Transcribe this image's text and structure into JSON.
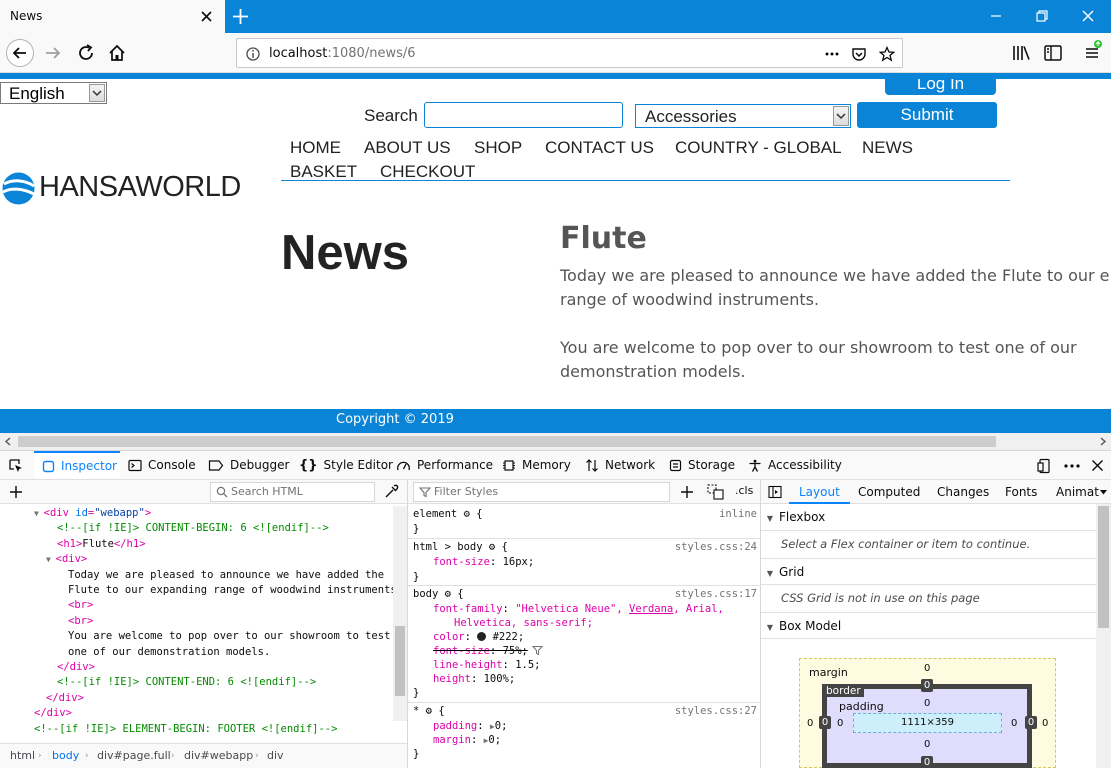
{
  "browser": {
    "tab_title": "News",
    "url_host": "localhost",
    "url_rest": ":1080/news/6"
  },
  "site": {
    "language": "English",
    "login_label": "Log In",
    "search_label": "Search",
    "search_value": "",
    "category": "Accessories",
    "submit_label": "Submit",
    "logo_text": "HANSAWORLD",
    "menu": [
      "HOME",
      "ABOUT US",
      "SHOP",
      "CONTACT US",
      "COUNTRY - GLOBAL",
      "NEWS",
      "BASKET",
      "CHECKOUT"
    ],
    "page_heading": "News",
    "article_title": "Flute",
    "article_p1_line1": "Today we are pleased to announce we have added the Flute to our e",
    "article_p1_line2": "range of woodwind instruments.",
    "article_p2_line1": "You are welcome to pop over to our showroom to test one of our",
    "article_p2_line2": "demonstration models.",
    "footer": "Copyright © 2019"
  },
  "devtools": {
    "tabs": [
      "Inspector",
      "Console",
      "Debugger",
      "Style Editor",
      "Performance",
      "Memory",
      "Network",
      "Storage",
      "Accessibility"
    ],
    "search_html_placeholder": "Search HTML",
    "filter_styles_placeholder": "Filter Styles",
    "cls_label": ".cls",
    "html_tree": [
      {
        "tag_open": "<div ",
        "attr": "id",
        "val": "\"webapp\"",
        "tag_close": ">"
      },
      {
        "comment": "<!--[if !IE]> CONTENT-BEGIN: 6 <![endif]-->"
      },
      {
        "h1_open": "<h1>",
        "h1_text": "Flute",
        "h1_close": "</h1>"
      },
      {
        "div_open": "<div>"
      },
      {
        "text1": "Today we are pleased to announce we have added the"
      },
      {
        "text2": "Flute to our expanding range of woodwind instruments."
      },
      {
        "br1": "<br>"
      },
      {
        "br2": "<br>"
      },
      {
        "text3": "You are welcome to pop over to our showroom to test"
      },
      {
        "text4": "one of our demonstration models."
      },
      {
        "div_close1": "</div>"
      },
      {
        "comment2": "<!--[if !IE]> CONTENT-END: 6 <![endif]-->"
      },
      {
        "div_close2": "</div>"
      },
      {
        "div_close3": "</div>"
      },
      {
        "comment3": "<!--[if !IE]> ELEMENT-BEGIN: FOOTER <![endif]-->"
      }
    ],
    "breadcrumbs": [
      "html",
      "body",
      "div#page.full",
      "div#webapp",
      "div"
    ],
    "rules": {
      "element": {
        "selector": "element",
        "brace": "{",
        "source": "inline",
        "close": "}"
      },
      "html_body": {
        "selector": "html > body",
        "brace": "{",
        "source": "styles.css:24",
        "prop": "font-size",
        "val": "16px;",
        "close": "}"
      },
      "body": {
        "selector": "body",
        "brace": "{",
        "source": "styles.css:17",
        "ff_prop": "font-family",
        "ff_val_a": "\"Helvetica Neue\", ",
        "ff_val_link": "Verdana",
        "ff_val_b": ", Arial,",
        "ff_val_c": "Helvetica, sans-serif;",
        "color_prop": "color",
        "color_val": "#222;",
        "fs_prop": "font-size",
        "fs_val": "75%;",
        "lh_prop": "line-height",
        "lh_val": "1.5;",
        "h_prop": "height",
        "h_val": "100%;",
        "close": "}"
      },
      "star": {
        "selector": "*",
        "brace": "{",
        "source": "styles.css:27",
        "p_prop": "padding",
        "p_val": "0;",
        "m_prop": "margin",
        "m_val": "0;",
        "close": "}"
      }
    },
    "side_tabs": [
      "Layout",
      "Computed",
      "Changes",
      "Fonts",
      "Animat"
    ],
    "flexbox": {
      "title": "Flexbox",
      "body": "Select a Flex container or item to continue."
    },
    "grid": {
      "title": "Grid",
      "body": "CSS Grid is not in use on this page"
    },
    "boxmodel": {
      "title": "Box Model",
      "margin_label": "margin",
      "border_label": "border",
      "padding_label": "padding",
      "content_size": "1111×359",
      "zero": "0"
    }
  },
  "colors": {
    "accent": "#0a84d6",
    "devtools_blue": "#0a84ff",
    "text": "#222"
  }
}
